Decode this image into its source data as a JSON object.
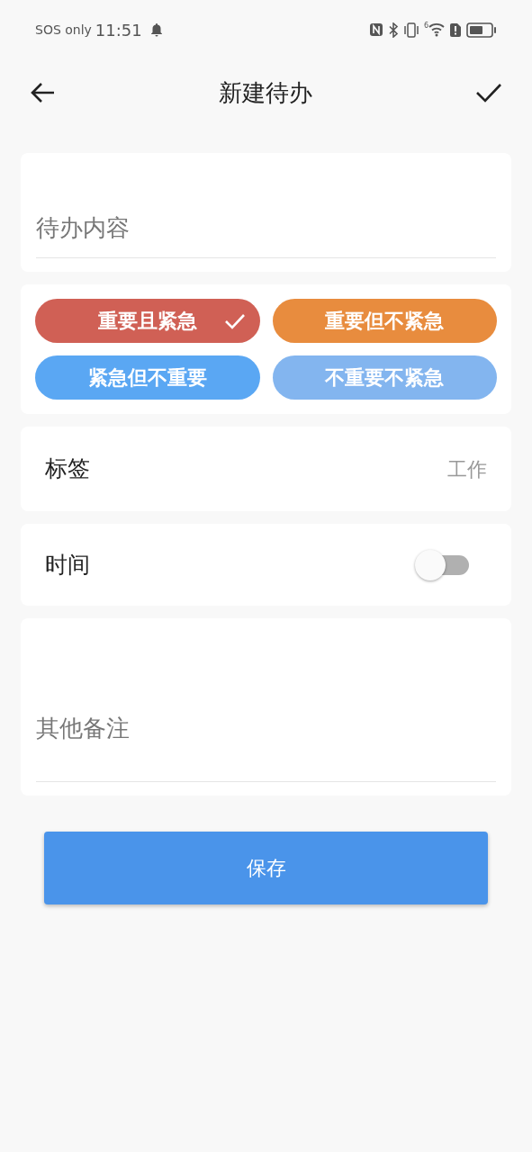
{
  "status_bar": {
    "carrier": "SOS only",
    "time": "11:51",
    "wifi_generation": "6"
  },
  "header": {
    "title": "新建待办"
  },
  "content": {
    "placeholder": "待办内容"
  },
  "priorities": [
    {
      "label": "重要且紧急",
      "color": "#d06055",
      "selected": true
    },
    {
      "label": "重要但不紧急",
      "color": "#e88c3e",
      "selected": false
    },
    {
      "label": "紧急但不重要",
      "color": "#5aa7f3",
      "selected": false
    },
    {
      "label": "不重要不紧急",
      "color": "#83b5ef",
      "selected": false
    }
  ],
  "tag": {
    "label": "标签",
    "value": "工作"
  },
  "time": {
    "label": "时间",
    "on": false
  },
  "notes": {
    "placeholder": "其他备注"
  },
  "save_button": "保存"
}
